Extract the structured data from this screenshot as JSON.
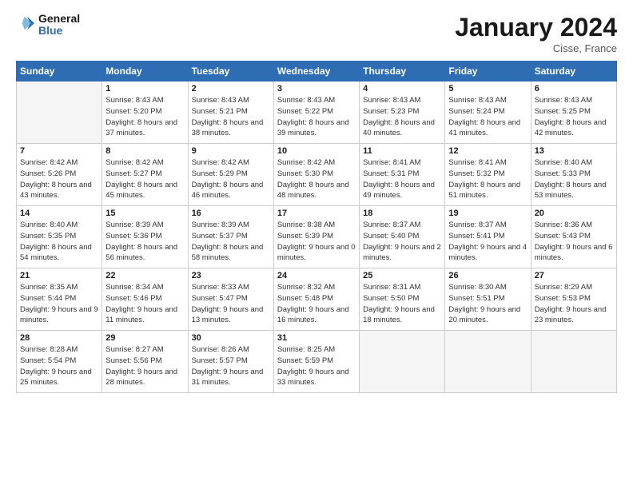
{
  "logo": {
    "line1": "General",
    "line2": "Blue"
  },
  "title": "January 2024",
  "location": "Cisse, France",
  "days_header": [
    "Sunday",
    "Monday",
    "Tuesday",
    "Wednesday",
    "Thursday",
    "Friday",
    "Saturday"
  ],
  "weeks": [
    [
      {
        "num": "",
        "sunrise": "",
        "sunset": "",
        "daylight": "",
        "empty": true
      },
      {
        "num": "1",
        "sunrise": "Sunrise: 8:43 AM",
        "sunset": "Sunset: 5:20 PM",
        "daylight": "Daylight: 8 hours and 37 minutes."
      },
      {
        "num": "2",
        "sunrise": "Sunrise: 8:43 AM",
        "sunset": "Sunset: 5:21 PM",
        "daylight": "Daylight: 8 hours and 38 minutes."
      },
      {
        "num": "3",
        "sunrise": "Sunrise: 8:43 AM",
        "sunset": "Sunset: 5:22 PM",
        "daylight": "Daylight: 8 hours and 39 minutes."
      },
      {
        "num": "4",
        "sunrise": "Sunrise: 8:43 AM",
        "sunset": "Sunset: 5:23 PM",
        "daylight": "Daylight: 8 hours and 40 minutes."
      },
      {
        "num": "5",
        "sunrise": "Sunrise: 8:43 AM",
        "sunset": "Sunset: 5:24 PM",
        "daylight": "Daylight: 8 hours and 41 minutes."
      },
      {
        "num": "6",
        "sunrise": "Sunrise: 8:43 AM",
        "sunset": "Sunset: 5:25 PM",
        "daylight": "Daylight: 8 hours and 42 minutes."
      }
    ],
    [
      {
        "num": "7",
        "sunrise": "Sunrise: 8:42 AM",
        "sunset": "Sunset: 5:26 PM",
        "daylight": "Daylight: 8 hours and 43 minutes."
      },
      {
        "num": "8",
        "sunrise": "Sunrise: 8:42 AM",
        "sunset": "Sunset: 5:27 PM",
        "daylight": "Daylight: 8 hours and 45 minutes."
      },
      {
        "num": "9",
        "sunrise": "Sunrise: 8:42 AM",
        "sunset": "Sunset: 5:29 PM",
        "daylight": "Daylight: 8 hours and 46 minutes."
      },
      {
        "num": "10",
        "sunrise": "Sunrise: 8:42 AM",
        "sunset": "Sunset: 5:30 PM",
        "daylight": "Daylight: 8 hours and 48 minutes."
      },
      {
        "num": "11",
        "sunrise": "Sunrise: 8:41 AM",
        "sunset": "Sunset: 5:31 PM",
        "daylight": "Daylight: 8 hours and 49 minutes."
      },
      {
        "num": "12",
        "sunrise": "Sunrise: 8:41 AM",
        "sunset": "Sunset: 5:32 PM",
        "daylight": "Daylight: 8 hours and 51 minutes."
      },
      {
        "num": "13",
        "sunrise": "Sunrise: 8:40 AM",
        "sunset": "Sunset: 5:33 PM",
        "daylight": "Daylight: 8 hours and 53 minutes."
      }
    ],
    [
      {
        "num": "14",
        "sunrise": "Sunrise: 8:40 AM",
        "sunset": "Sunset: 5:35 PM",
        "daylight": "Daylight: 8 hours and 54 minutes."
      },
      {
        "num": "15",
        "sunrise": "Sunrise: 8:39 AM",
        "sunset": "Sunset: 5:36 PM",
        "daylight": "Daylight: 8 hours and 56 minutes."
      },
      {
        "num": "16",
        "sunrise": "Sunrise: 8:39 AM",
        "sunset": "Sunset: 5:37 PM",
        "daylight": "Daylight: 8 hours and 58 minutes."
      },
      {
        "num": "17",
        "sunrise": "Sunrise: 8:38 AM",
        "sunset": "Sunset: 5:39 PM",
        "daylight": "Daylight: 9 hours and 0 minutes."
      },
      {
        "num": "18",
        "sunrise": "Sunrise: 8:37 AM",
        "sunset": "Sunset: 5:40 PM",
        "daylight": "Daylight: 9 hours and 2 minutes."
      },
      {
        "num": "19",
        "sunrise": "Sunrise: 8:37 AM",
        "sunset": "Sunset: 5:41 PM",
        "daylight": "Daylight: 9 hours and 4 minutes."
      },
      {
        "num": "20",
        "sunrise": "Sunrise: 8:36 AM",
        "sunset": "Sunset: 5:43 PM",
        "daylight": "Daylight: 9 hours and 6 minutes."
      }
    ],
    [
      {
        "num": "21",
        "sunrise": "Sunrise: 8:35 AM",
        "sunset": "Sunset: 5:44 PM",
        "daylight": "Daylight: 9 hours and 9 minutes."
      },
      {
        "num": "22",
        "sunrise": "Sunrise: 8:34 AM",
        "sunset": "Sunset: 5:46 PM",
        "daylight": "Daylight: 9 hours and 11 minutes."
      },
      {
        "num": "23",
        "sunrise": "Sunrise: 8:33 AM",
        "sunset": "Sunset: 5:47 PM",
        "daylight": "Daylight: 9 hours and 13 minutes."
      },
      {
        "num": "24",
        "sunrise": "Sunrise: 8:32 AM",
        "sunset": "Sunset: 5:48 PM",
        "daylight": "Daylight: 9 hours and 16 minutes."
      },
      {
        "num": "25",
        "sunrise": "Sunrise: 8:31 AM",
        "sunset": "Sunset: 5:50 PM",
        "daylight": "Daylight: 9 hours and 18 minutes."
      },
      {
        "num": "26",
        "sunrise": "Sunrise: 8:30 AM",
        "sunset": "Sunset: 5:51 PM",
        "daylight": "Daylight: 9 hours and 20 minutes."
      },
      {
        "num": "27",
        "sunrise": "Sunrise: 8:29 AM",
        "sunset": "Sunset: 5:53 PM",
        "daylight": "Daylight: 9 hours and 23 minutes."
      }
    ],
    [
      {
        "num": "28",
        "sunrise": "Sunrise: 8:28 AM",
        "sunset": "Sunset: 5:54 PM",
        "daylight": "Daylight: 9 hours and 25 minutes."
      },
      {
        "num": "29",
        "sunrise": "Sunrise: 8:27 AM",
        "sunset": "Sunset: 5:56 PM",
        "daylight": "Daylight: 9 hours and 28 minutes."
      },
      {
        "num": "30",
        "sunrise": "Sunrise: 8:26 AM",
        "sunset": "Sunset: 5:57 PM",
        "daylight": "Daylight: 9 hours and 31 minutes."
      },
      {
        "num": "31",
        "sunrise": "Sunrise: 8:25 AM",
        "sunset": "Sunset: 5:59 PM",
        "daylight": "Daylight: 9 hours and 33 minutes."
      },
      {
        "num": "",
        "sunrise": "",
        "sunset": "",
        "daylight": "",
        "empty": true
      },
      {
        "num": "",
        "sunrise": "",
        "sunset": "",
        "daylight": "",
        "empty": true
      },
      {
        "num": "",
        "sunrise": "",
        "sunset": "",
        "daylight": "",
        "empty": true
      }
    ]
  ]
}
